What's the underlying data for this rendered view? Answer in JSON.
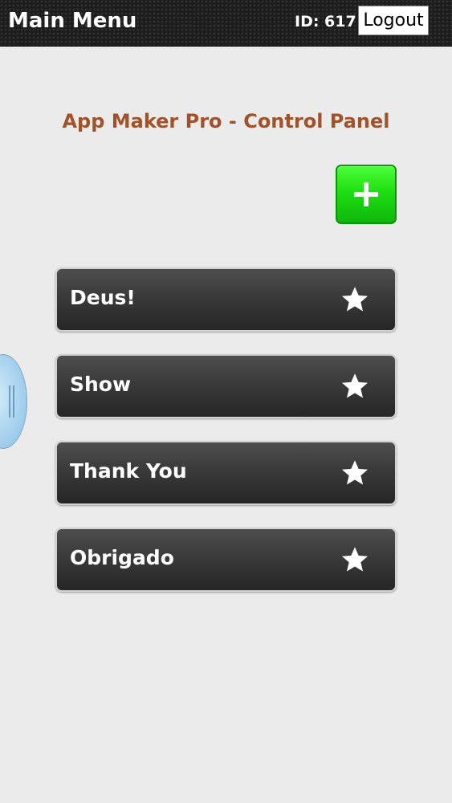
{
  "header": {
    "title": "Main Menu",
    "user_id": "ID: 617",
    "logout_label": "Logout"
  },
  "panel": {
    "title": "App Maker Pro - Control Panel",
    "add_icon": "plus-icon"
  },
  "items": [
    {
      "label": "Deus!",
      "icon": "star-icon"
    },
    {
      "label": "Show",
      "icon": "star-icon"
    },
    {
      "label": "Thank You",
      "icon": "star-icon"
    },
    {
      "label": "Obrigado",
      "icon": "star-icon"
    }
  ],
  "colors": {
    "title_accent": "#a0532a",
    "add_button": "#1fdf12",
    "item_background": "#3a3a3a",
    "page_background": "#ebebeb"
  }
}
